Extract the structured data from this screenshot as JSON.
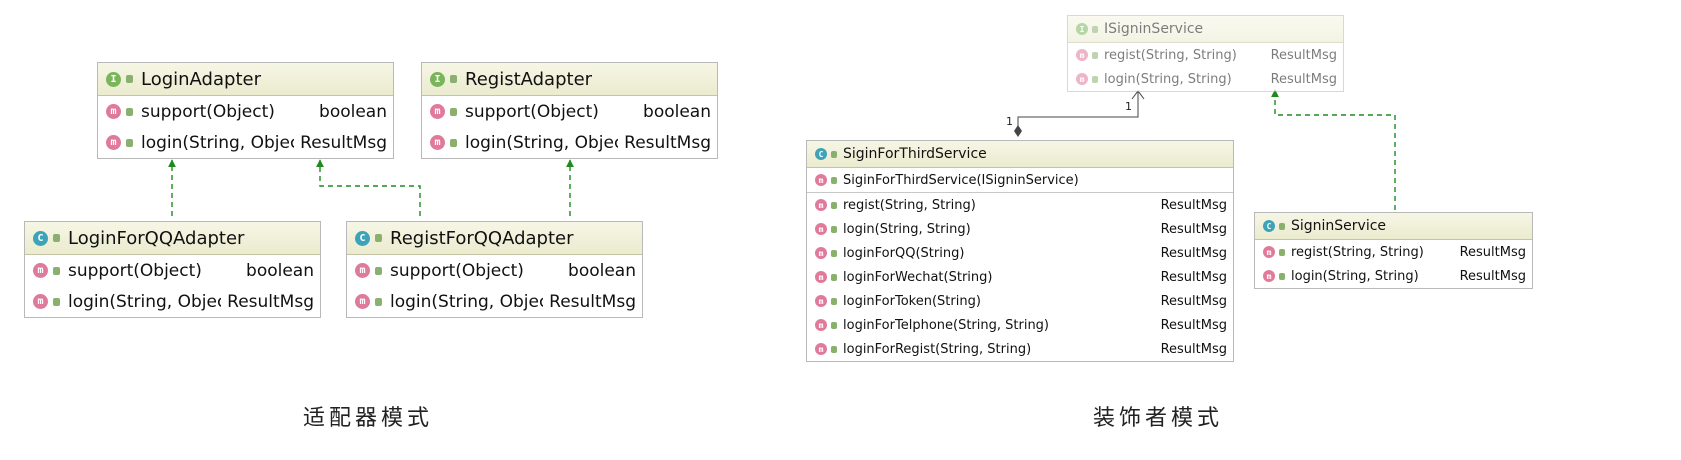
{
  "adapter": {
    "caption": "适配器模式",
    "boxes": {
      "login_adapter": {
        "kind": "I",
        "name": "LoginAdapter",
        "methods": [
          {
            "name": "support(Object)",
            "ret": "boolean"
          },
          {
            "name": "login(String, Object)",
            "ret": "ResultMsg"
          }
        ]
      },
      "regist_adapter": {
        "kind": "I",
        "name": "RegistAdapter",
        "methods": [
          {
            "name": "support(Object)",
            "ret": "boolean"
          },
          {
            "name": "login(String, Object)",
            "ret": "ResultMsg"
          }
        ]
      },
      "login_for_qq_adapter": {
        "kind": "C",
        "name": "LoginForQQAdapter",
        "methods": [
          {
            "name": "support(Object)",
            "ret": "boolean"
          },
          {
            "name": "login(String, Object)",
            "ret": "ResultMsg"
          }
        ]
      },
      "regist_for_qq_adapter": {
        "kind": "C",
        "name": "RegistForQQAdapter",
        "methods": [
          {
            "name": "support(Object)",
            "ret": "boolean"
          },
          {
            "name": "login(String, Object)",
            "ret": "ResultMsg"
          }
        ]
      }
    }
  },
  "decorator": {
    "caption": "装饰者模式",
    "boxes": {
      "isignin_service": {
        "kind": "I",
        "name": "ISigninService",
        "methods": [
          {
            "name": "regist(String, String)",
            "ret": "ResultMsg"
          },
          {
            "name": "login(String, String)",
            "ret": "ResultMsg"
          }
        ]
      },
      "sigin_for_third_service": {
        "kind": "C",
        "name": "SiginForThirdService",
        "constructors": [
          {
            "name": "SiginForThirdService(ISigninService)",
            "ret": ""
          }
        ],
        "methods": [
          {
            "name": "regist(String, String)",
            "ret": "ResultMsg"
          },
          {
            "name": "login(String, String)",
            "ret": "ResultMsg"
          },
          {
            "name": "loginForQQ(String)",
            "ret": "ResultMsg"
          },
          {
            "name": "loginForWechat(String)",
            "ret": "ResultMsg"
          },
          {
            "name": "loginForToken(String)",
            "ret": "ResultMsg"
          },
          {
            "name": "loginForTelphone(String, String)",
            "ret": "ResultMsg"
          },
          {
            "name": "loginForRegist(String, String)",
            "ret": "ResultMsg"
          }
        ]
      },
      "signin_service": {
        "kind": "C",
        "name": "SigninService",
        "methods": [
          {
            "name": "regist(String, String)",
            "ret": "ResultMsg"
          },
          {
            "name": "login(String, String)",
            "ret": "ResultMsg"
          }
        ]
      }
    },
    "multiplicity": {
      "source": "1",
      "target": "1"
    }
  },
  "badges": {
    "interface": "I",
    "class": "C",
    "method": "m"
  },
  "colors": {
    "interface_badge": "#7ab55c",
    "class_badge": "#3fa3b8",
    "method_badge": "#e07a9a",
    "realization_line": "#1e8a1e"
  }
}
